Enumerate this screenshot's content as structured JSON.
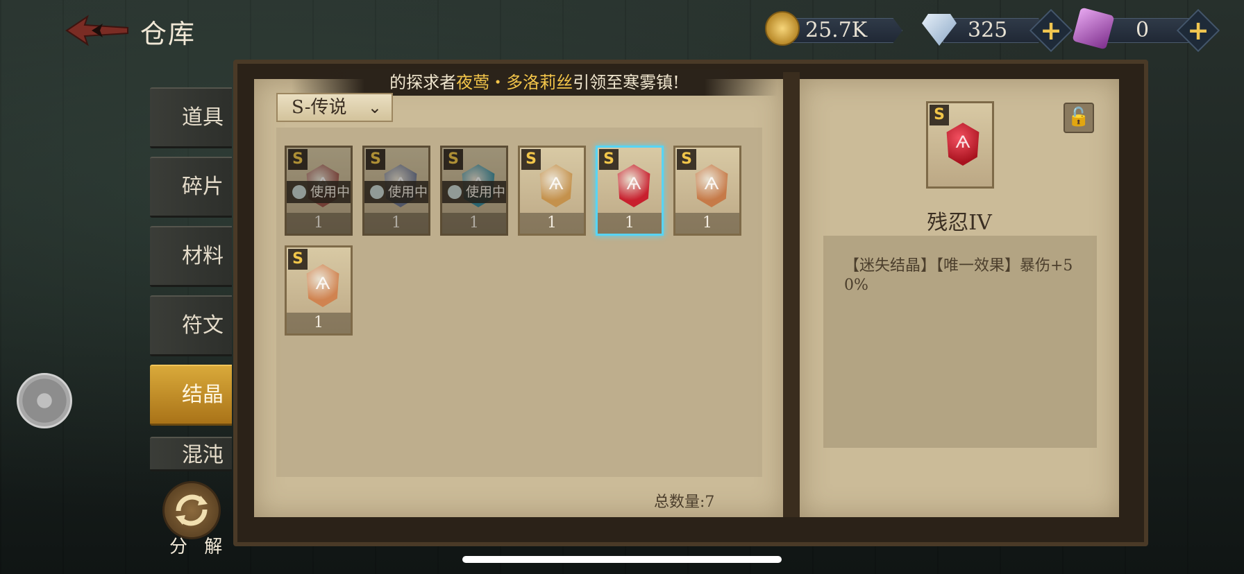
{
  "header": {
    "title": "仓库",
    "currencies": [
      {
        "icon": "gold-coin-icon",
        "value": "25.7K",
        "has_plus": false
      },
      {
        "icon": "diamond-icon",
        "value": "325",
        "has_plus": true
      },
      {
        "icon": "purple-crystal-icon",
        "value": "0",
        "has_plus": true
      }
    ]
  },
  "tabs": [
    {
      "label": "道具",
      "active": false
    },
    {
      "label": "碎片",
      "active": false
    },
    {
      "label": "材料",
      "active": false
    },
    {
      "label": "符文",
      "active": false
    },
    {
      "label": "结晶",
      "active": true
    },
    {
      "label": "混沌",
      "active": false
    }
  ],
  "ticker": {
    "prefix": "的探求者",
    "highlight": "夜莺・多洛莉丝",
    "suffix": "引领至寒雾镇!"
  },
  "filter": {
    "label": "S-传说"
  },
  "items": [
    {
      "rank": "S",
      "in_use_label": "使用中",
      "qty": "1",
      "color": "#a0564a",
      "selected": false
    },
    {
      "rank": "S",
      "in_use_label": "使用中",
      "qty": "1",
      "color": "#6f7790",
      "selected": false
    },
    {
      "rank": "S",
      "in_use_label": "使用中",
      "qty": "1",
      "color": "#3b8c9c",
      "selected": false
    },
    {
      "rank": "S",
      "in_use_label": "",
      "qty": "1",
      "color": "#c4914c",
      "selected": false
    },
    {
      "rank": "S",
      "in_use_label": "",
      "qty": "1",
      "color": "#c8202e",
      "selected": true
    },
    {
      "rank": "S",
      "in_use_label": "",
      "qty": "1",
      "color": "#c67a48",
      "selected": false
    },
    {
      "rank": "S",
      "in_use_label": "",
      "qty": "1",
      "color": "#d08350",
      "selected": false
    }
  ],
  "total_label": "总数量:7",
  "detail": {
    "rank": "S",
    "name": "残忍IV",
    "description": "【迷失结晶】【唯一效果】暴伤+50%"
  },
  "buttons": {
    "decompose": "分 解"
  }
}
